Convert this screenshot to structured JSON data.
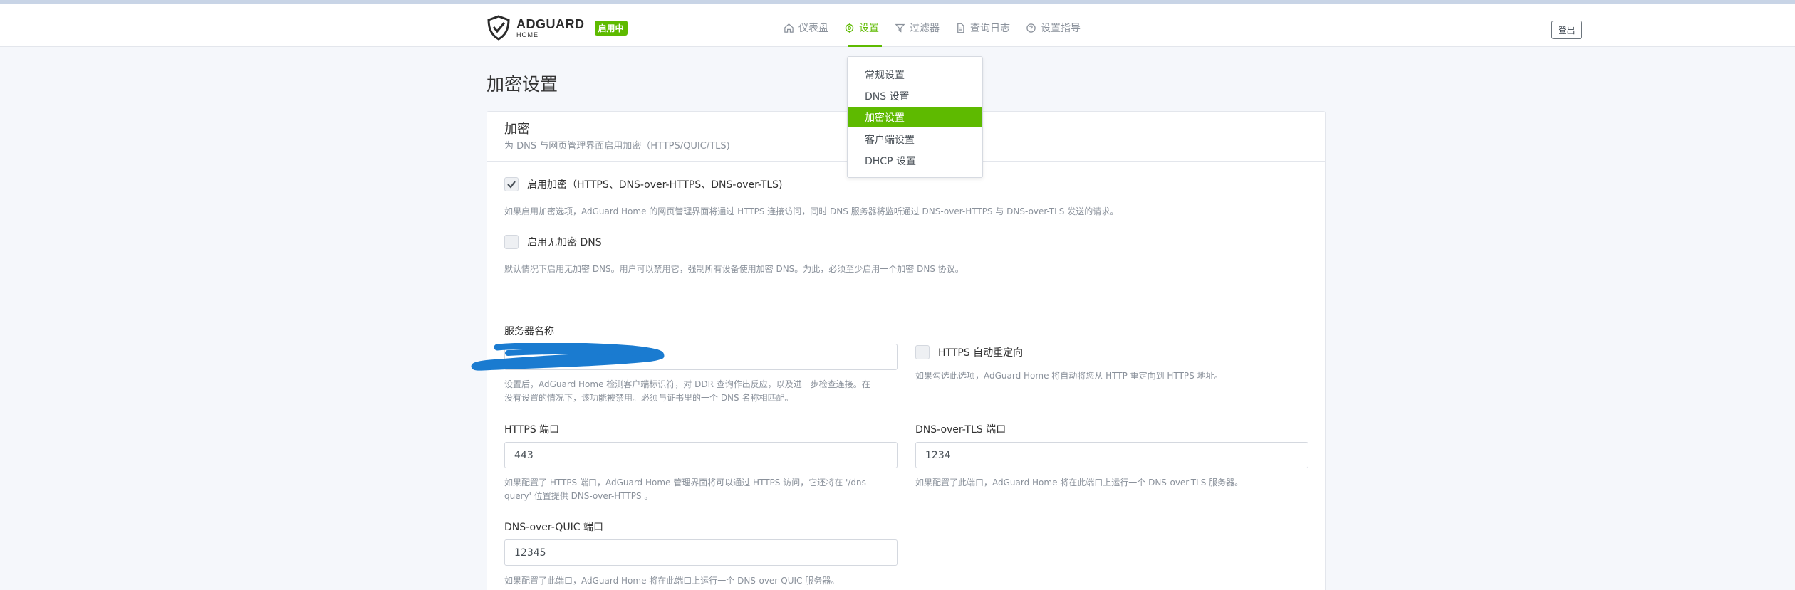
{
  "header": {
    "logo_main": "ADGUARD",
    "logo_sub": "HOME",
    "status_badge": "启用中",
    "nav": [
      {
        "label": "仪表盘",
        "icon": "home-icon"
      },
      {
        "label": "设置",
        "icon": "gear-icon"
      },
      {
        "label": "过滤器",
        "icon": "filter-icon"
      },
      {
        "label": "查询日志",
        "icon": "document-icon"
      },
      {
        "label": "设置指导",
        "icon": "help-circle-icon"
      }
    ],
    "logout_label": "登出"
  },
  "settings_menu": {
    "items": [
      "常规设置",
      "DNS 设置",
      "加密设置",
      "客户端设置",
      "DHCP 设置"
    ],
    "active_index": 2
  },
  "page": {
    "title": "加密设置"
  },
  "card": {
    "title": "加密",
    "subtitle": "为 DNS 与网页管理界面启用加密（HTTPS/QUIC/TLS)",
    "enable_encryption": {
      "label": "启用加密（HTTPS、DNS-over-HTTPS、DNS-over-TLS)",
      "checked": true,
      "help": "如果启用加密选项，AdGuard Home 的网页管理界面将通过 HTTPS 连接访问，同时 DNS 服务器将监听通过 DNS-over-HTTPS 与 DNS-over-TLS 发送的请求。"
    },
    "enable_plain_dns": {
      "label": "启用无加密 DNS",
      "checked": false,
      "help": "默认情况下启用无加密 DNS。用户可以禁用它，强制所有设备使用加密 DNS。为此，必须至少启用一个加密 DNS 协议。"
    },
    "server_name": {
      "label": "服务器名称",
      "value": "",
      "help_line1": "设置后，AdGuard Home 检测客户端标识符，对 DDR 查询作出反应，以及进一步检查连接。在",
      "help_line2": "没有设置的情况下，该功能被禁用。必须与证书里的一个 DNS 名称相匹配。"
    },
    "https_redirect": {
      "label": "HTTPS 自动重定向",
      "checked": false,
      "help": "如果勾选此选项，AdGuard Home 将自动将您从 HTTP 重定向到 HTTPS 地址。"
    },
    "https_port": {
      "label": "HTTPS 端口",
      "value": "443",
      "help_line1": "如果配置了 HTTPS 端口，AdGuard Home 管理界面将可以通过 HTTPS 访问，它还将在 '/dns-",
      "help_line2": "query' 位置提供 DNS-over-HTTPS 。"
    },
    "tls_port": {
      "label": "DNS-over-TLS 端口",
      "value": "1234",
      "help": "如果配置了此端口，AdGuard Home 将在此端口上运行一个 DNS-over-TLS 服务器。"
    },
    "quic_port": {
      "label": "DNS-over-QUIC 端口",
      "value": "12345",
      "help": "如果配置了此端口，AdGuard Home 将在此端口上运行一个 DNS-over-QUIC 服务器。"
    }
  },
  "colors": {
    "accent": "#5eba00",
    "redaction": "#1a7bd0"
  }
}
